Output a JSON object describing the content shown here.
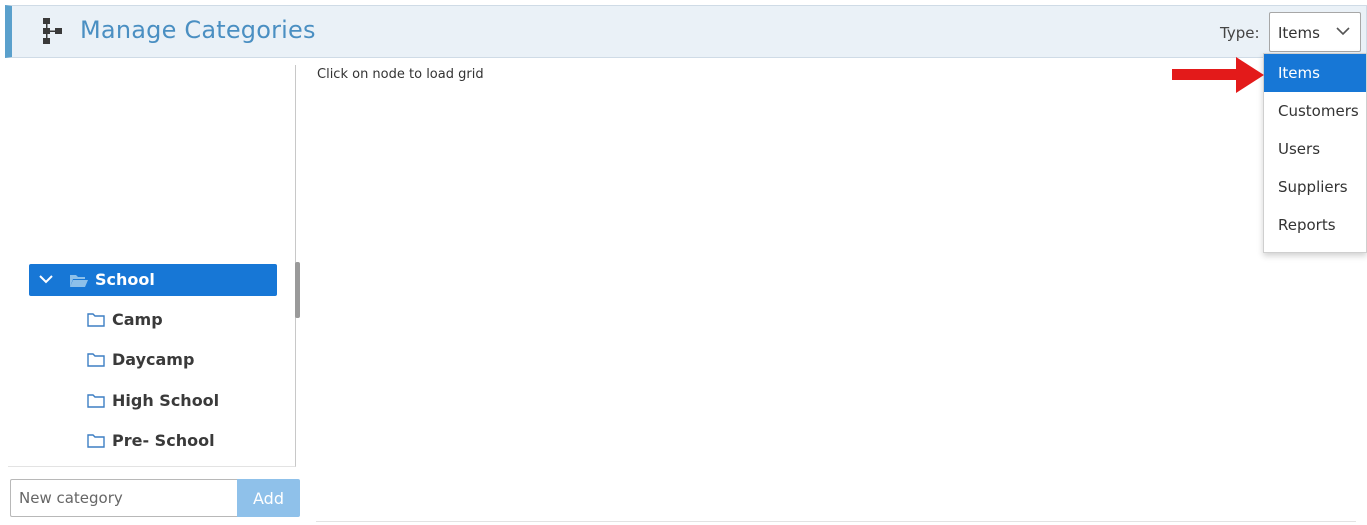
{
  "header": {
    "title": "Manage Categories",
    "icon": "category-tree-icon",
    "type_label": "Type:",
    "type_select_value": "Items"
  },
  "type_dropdown": {
    "options": [
      "Items",
      "Customers",
      "Users",
      "Suppliers",
      "Reports"
    ],
    "selected": "Items"
  },
  "tree": {
    "root": {
      "label": "School",
      "expanded": true,
      "selected": true
    },
    "children": [
      {
        "label": "Camp"
      },
      {
        "label": "Daycamp"
      },
      {
        "label": "High School"
      },
      {
        "label": "Pre- School"
      }
    ]
  },
  "main": {
    "hint": "Click on node to load grid"
  },
  "add_category": {
    "placeholder": "New category",
    "button_label": "Add"
  },
  "colors": {
    "accent": "#1777d6",
    "title": "#4a8fc2",
    "header_bg": "#eaf1f7",
    "add_button": "#8fc1ea",
    "annotation_arrow": "#e31a1a"
  }
}
